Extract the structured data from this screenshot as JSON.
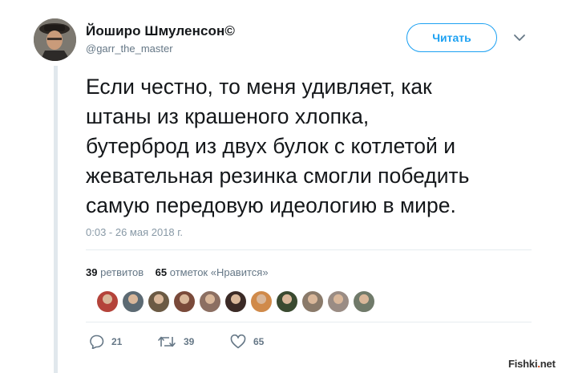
{
  "author": {
    "display_name": "Йоширо Шмуленсон©",
    "handle": "@garr_the_master"
  },
  "follow_button": {
    "label": "Читать"
  },
  "tweet": {
    "text": "Если честно, то меня удивляет, как\nштаны из крашеного хлопка,\nбутерброд из двух булок с котлетой и\nжевательная резинка смогли победить\nсамую передовую идеологию в мире.",
    "timestamp": "0:03 - 26 мая 2018 г."
  },
  "stats": {
    "retweets_count": "39",
    "retweets_label": "ретвитов",
    "likes_count": "65",
    "likes_label": "отметок «Нравится»"
  },
  "liker_avatars": [
    {
      "color": "#b4433a"
    },
    {
      "color": "#5c6a73"
    },
    {
      "color": "#6b5a44"
    },
    {
      "color": "#7a4a3a"
    },
    {
      "color": "#8c6f62"
    },
    {
      "color": "#3b2a26"
    },
    {
      "color": "#d08a4a"
    },
    {
      "color": "#3a4a30"
    },
    {
      "color": "#8a7a6a"
    },
    {
      "color": "#9a8c84"
    },
    {
      "color": "#707a6a"
    }
  ],
  "actions": {
    "reply": {
      "icon": "reply-icon",
      "count": "21"
    },
    "retweet": {
      "icon": "retweet-icon",
      "count": "39"
    },
    "like": {
      "icon": "heart-icon",
      "count": "65"
    }
  },
  "watermark": {
    "text_main": "Fishki",
    "text_dot": ".",
    "text_end": "net"
  },
  "colors": {
    "accent": "#1da1f2",
    "secondary_text": "#657786",
    "divider": "#e6ecf0"
  }
}
